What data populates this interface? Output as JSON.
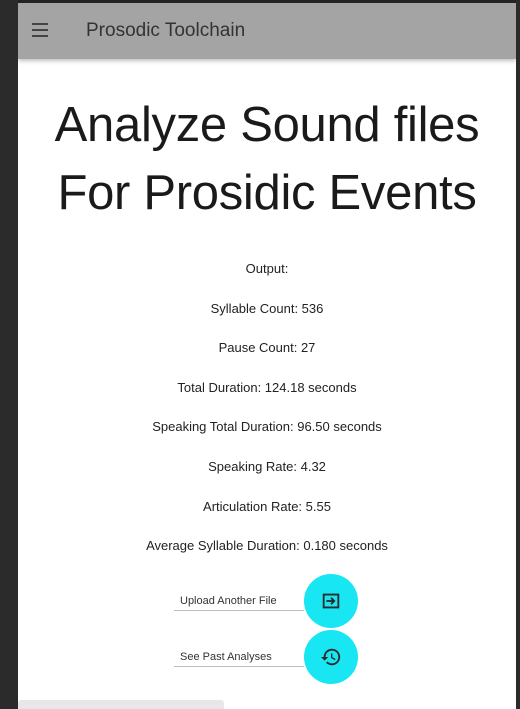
{
  "toolbar": {
    "title": "Prosodic Toolchain",
    "menu_icon": "hamburger-menu-icon"
  },
  "headline": {
    "line1": "Analyze Sound files",
    "line2": "For Prosidic Events"
  },
  "output": {
    "label": "Output:",
    "syllable_count": "Syllable Count: 536",
    "pause_count": "Pause Count: 27",
    "total_duration": "Total Duration: 124.18 seconds",
    "speaking_total_duration": "Speaking Total Duration: 96.50 seconds",
    "speaking_rate": "Speaking Rate: 4.32",
    "articulation_rate": "Articulation Rate: 5.55",
    "average_syllable_duration": "Average Syllable Duration: 0.180 seconds"
  },
  "actions": {
    "upload_label": "Upload Another File",
    "upload_icon": "upload-file-icon",
    "history_label": "See Past Analyses",
    "history_icon": "history-icon"
  },
  "colors": {
    "toolbar_bg": "#a4a4a4",
    "accent": "#18e6f2"
  }
}
